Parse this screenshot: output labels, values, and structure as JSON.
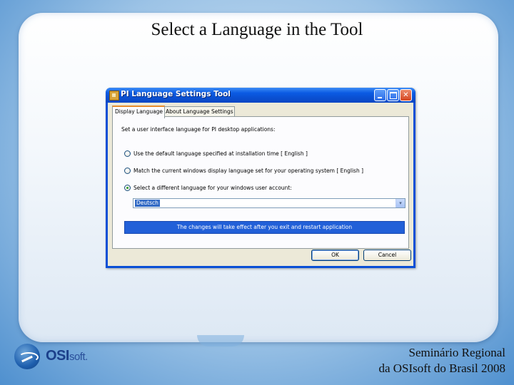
{
  "slide": {
    "title": "Select a Language in the Tool",
    "footer_line1": "Seminário Regional",
    "footer_line2": "da OSIsoft do Brasil 2008"
  },
  "logo": {
    "text_bold": "OSI",
    "text_light": "soft",
    "mark": "."
  },
  "window": {
    "title": "PI Language Settings Tool",
    "icon": "app-icon",
    "controls": {
      "minimize": "minimize-icon",
      "maximize": "maximize-icon",
      "close": "✕"
    },
    "tabs": [
      {
        "label": "Display Language",
        "active": true
      },
      {
        "label": "About Language Settings",
        "active": false
      }
    ],
    "instruction": "Set a user interface language for PI desktop applications:",
    "options": [
      {
        "label": "Use the default language specified at installation time [ English ]",
        "checked": false
      },
      {
        "label": "Match the current windows display language set for your operating system [ English ]",
        "checked": false
      },
      {
        "label": "Select a different language for your windows user account:",
        "checked": true
      }
    ],
    "language_select": {
      "value": "Deutsch",
      "arrow": "▾"
    },
    "notice": "The changes will take effect after you exit and restart application",
    "buttons": {
      "ok": "OK",
      "cancel": "Cancel"
    }
  }
}
